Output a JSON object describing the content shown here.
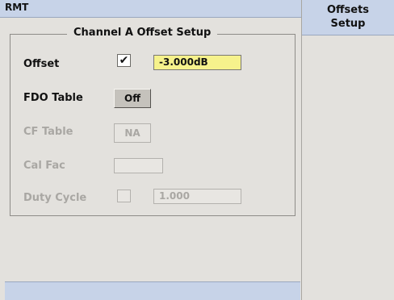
{
  "header": {
    "title": "RMT"
  },
  "panel": {
    "title": "Channel A Offset Setup",
    "offset": {
      "label": "Offset",
      "checked": "✔",
      "value": "-3.000dB"
    },
    "fdo_table": {
      "label": "FDO Table",
      "button": "Off"
    },
    "cf_table": {
      "label": "CF Table",
      "button": "NA"
    },
    "cal_fac": {
      "label": "Cal Fac",
      "value": ""
    },
    "duty_cycle": {
      "label": "Duty Cycle",
      "value": "1.000"
    }
  },
  "softkeys": {
    "key1": {
      "line1": "Offsets",
      "line2": "Setup"
    }
  },
  "colors": {
    "title_bar": "#c7d3e8",
    "active_field": "#f6f28c",
    "background": "#e3e1dd"
  }
}
